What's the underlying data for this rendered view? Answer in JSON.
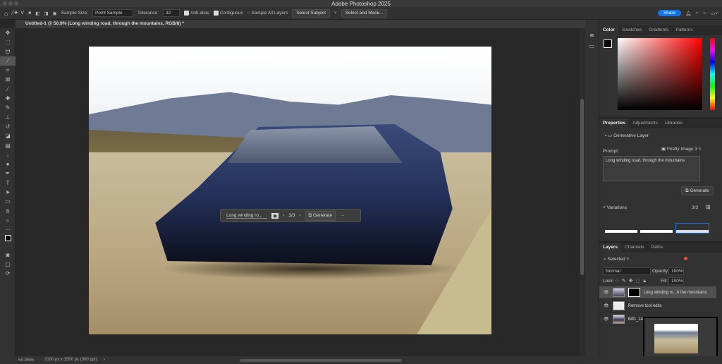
{
  "app": {
    "title": "Adobe Photoshop 2025",
    "share": "Share"
  },
  "options": {
    "sample_size_label": "Sample Size:",
    "sample_size": "Point Sample",
    "tolerance_label": "Tolerance:",
    "tolerance": "32",
    "anti_alias": "Anti-alias",
    "contiguous": "Contiguous",
    "sample_all": "Sample All Layers",
    "select_subject": "Select Subject",
    "select_mask": "Select and Mask..."
  },
  "document": {
    "tab": "Untitled-1 @ 50.9% (Long winding road, through the mountains, RGB/8) *"
  },
  "context_bar": {
    "prompt": "Long winding ro...",
    "count": "3/3",
    "generate": "Generate"
  },
  "color_panel": {
    "tabs": [
      "Color",
      "Swatches",
      "Gradients",
      "Patterns"
    ]
  },
  "properties": {
    "tabs": [
      "Properties",
      "Adjustments",
      "Libraries"
    ],
    "layer_type": "Generative Layer",
    "prompt_label": "Prompt:",
    "model": "Firefly Image 3",
    "prompt": "Long winding road, through the mountains",
    "generate": "Generate",
    "variations_label": "Variations",
    "variations_count": "3/3"
  },
  "layers": {
    "tabs": [
      "Layers",
      "Channels",
      "Paths"
    ],
    "filter": "Selected",
    "blend": "Normal",
    "opacity_label": "Opacity:",
    "opacity": "100%",
    "lock_label": "Lock:",
    "fill_label": "Fill:",
    "fill": "100%",
    "items": [
      {
        "name": "Long winding ro...h the mountains",
        "selected": true
      },
      {
        "name": "Remove tool edits"
      },
      {
        "name": "IMG_1467"
      }
    ]
  },
  "status": {
    "zoom": "50.95%",
    "info": "2100 px x 1500 px (300 ppi)"
  },
  "colors": {
    "accent": "#1473e6"
  }
}
